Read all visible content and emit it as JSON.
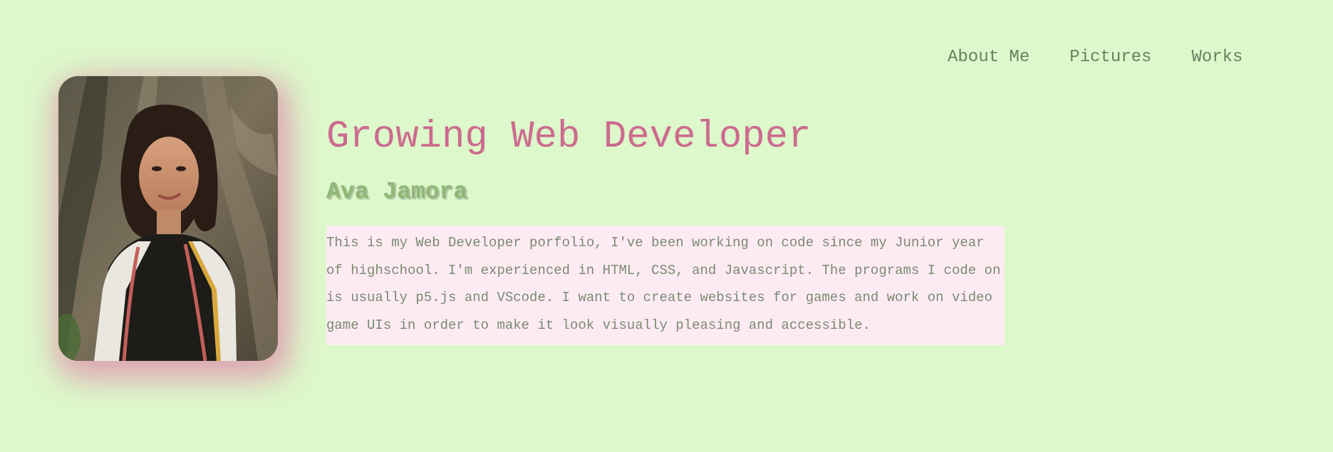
{
  "nav": {
    "items": [
      "About Me",
      "Pictures",
      "Works"
    ]
  },
  "profile": {
    "photo_icon": "portrait-photo",
    "shadow_color": "#de8caa"
  },
  "hero": {
    "title": "Growing Web Developer",
    "name": "Ava Jamora",
    "bio": "This is my Web Developer porfolio, I've been working on code since my Junior year of highschool. I'm experienced in HTML, CSS, and Javascript. The programs I code on is usually p5.js and VScode. I want to create websites for games and work on video game UIs in order to make it look visually pleasing and accessible."
  },
  "colors": {
    "background": "#ddf8cb",
    "title": "#cc6b8e",
    "name": "#8fb877",
    "text": "#7b8a72",
    "bio_background": "#fdebf3"
  }
}
